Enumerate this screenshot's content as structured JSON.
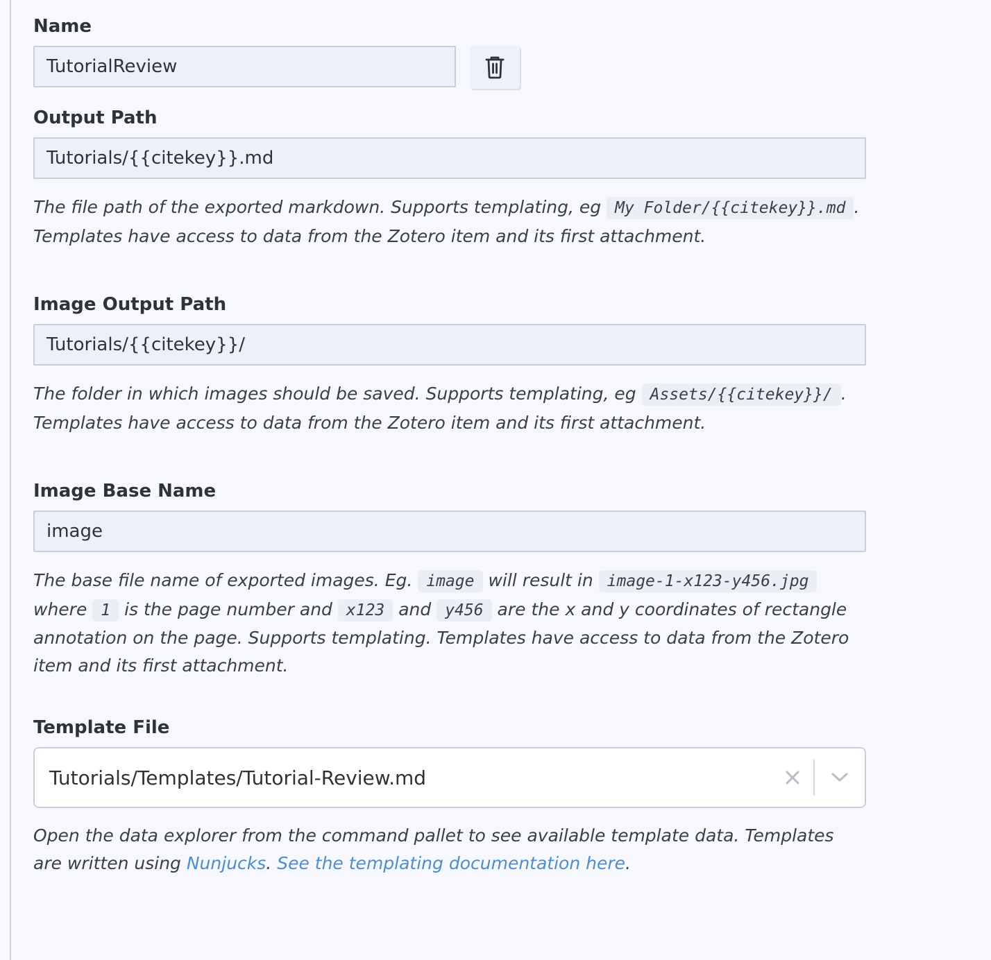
{
  "name_field": {
    "label": "Name",
    "value": "TutorialReview",
    "delete_icon": "trash-icon"
  },
  "output_path": {
    "label": "Output Path",
    "value": "Tutorials/{{citekey}}.md",
    "desc_1": "The file path of the exported markdown. Supports templating, eg ",
    "desc_code": "My Folder/{{citekey}}.md",
    "desc_2": ". Templates have access to data from the Zotero item and its first attachment."
  },
  "image_output_path": {
    "label": "Image Output Path",
    "value": "Tutorials/{{citekey}}/",
    "desc_1": "The folder in which images should be saved. Supports templating, eg ",
    "desc_code": "Assets/{{citekey}}/",
    "desc_2": ". Templates have access to data from the Zotero item and its first attachment."
  },
  "image_base_name": {
    "label": "Image Base Name",
    "value": "image",
    "desc_1": "The base file name of exported images. Eg. ",
    "code_1": "image",
    "desc_2": " will result in ",
    "code_2": "image-1-x123-y456.jpg",
    "desc_3": " where ",
    "code_3": "1",
    "desc_4": " is the page number and ",
    "code_4": "x123",
    "desc_5": " and ",
    "code_5": "y456",
    "desc_6": " are the x and y coordinates of rectangle annotation on the page. Supports templating. Templates have access to data from the Zotero item and its first attachment."
  },
  "template_file": {
    "label": "Template File",
    "value": "Tutorials/Templates/Tutorial-Review.md",
    "clear_icon": "close-icon",
    "dropdown_icon": "chevron-down-icon",
    "desc_1": "Open the data explorer from the command pallet to see available template data. Templates are written using ",
    "link_1": "Nunjucks",
    "desc_2": ". ",
    "link_2": "See the templating documentation here",
    "desc_3": "."
  },
  "colors": {
    "background": "#f7f8fe",
    "input_bg": "#ecf0f8",
    "input_border": "#c9cedb",
    "text": "#2e3338",
    "link": "#4f8dc8"
  }
}
